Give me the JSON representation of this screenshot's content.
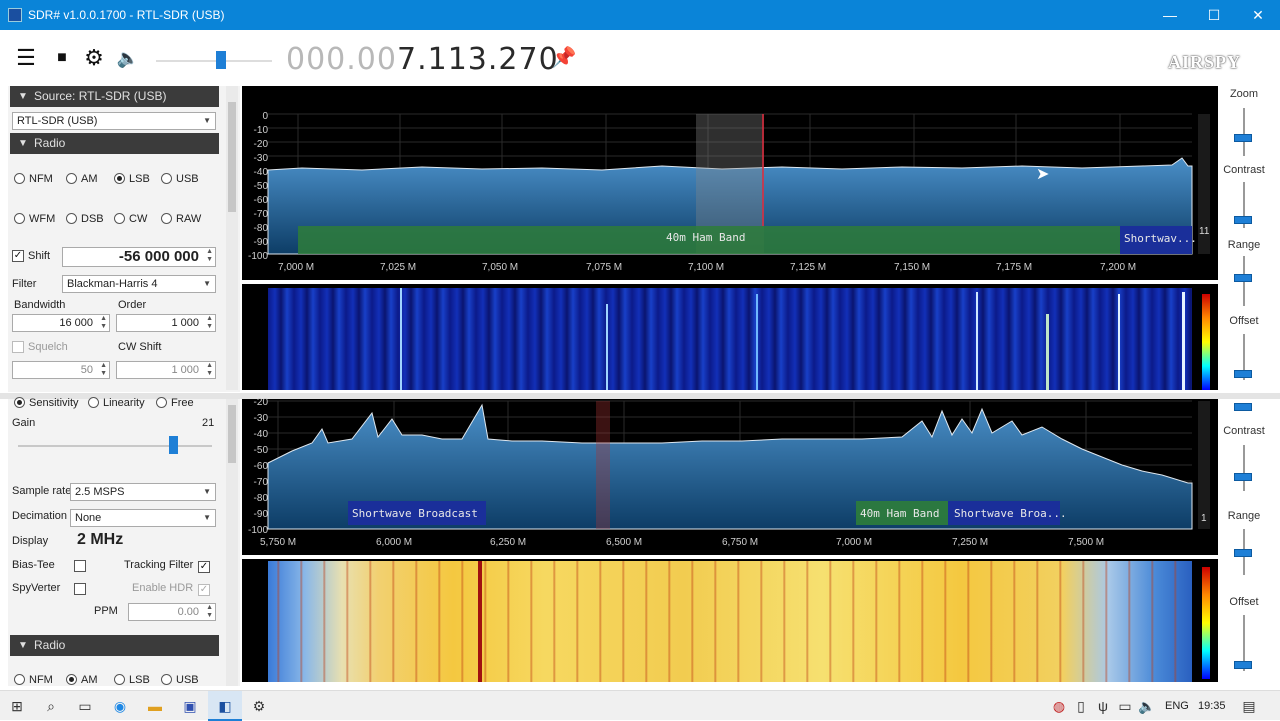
{
  "window": {
    "title": "SDR# v1.0.0.1700 - RTL-SDR (USB)",
    "minimize": "—",
    "maximize": "☐",
    "close": "✕"
  },
  "toolbar": {
    "freq_dim": "000.00",
    "freq_main": "7.113.270",
    "logo": "AIRSPY"
  },
  "panel1": {
    "source_header": "Source: RTL-SDR (USB)",
    "source_select": "RTL-SDR (USB)",
    "radio_header": "Radio",
    "modes_row1": [
      "NFM",
      "AM",
      "LSB",
      "USB"
    ],
    "modes_row2": [
      "WFM",
      "DSB",
      "CW",
      "RAW"
    ],
    "selected_mode": "LSB",
    "shift_label": "Shift",
    "shift_value": "-56 000 000",
    "filter_label": "Filter",
    "filter_value": "Blackman-Harris 4",
    "bandwidth_label": "Bandwidth",
    "bandwidth_value": "16 000",
    "order_label": "Order",
    "order_value": "1 000",
    "squelch_label": "Squelch",
    "squelch_value": "50",
    "cwshift_label": "CW Shift",
    "cwshift_value": "1 000"
  },
  "spectrum1": {
    "y_ticks": [
      "0",
      "-10",
      "-20",
      "-30",
      "-40",
      "-50",
      "-60",
      "-70",
      "-80",
      "-90",
      "-100"
    ],
    "x_ticks": [
      "7,000 M",
      "7,025 M",
      "7,050 M",
      "7,075 M",
      "7,100 M",
      "7,125 M",
      "7,150 M",
      "7,175 M",
      "7,200 M"
    ],
    "band_label": "40m Ham Band",
    "band2_label": "Shortwav...",
    "side_number": "11"
  },
  "side1": {
    "zoom": "Zoom",
    "contrast": "Contrast",
    "range": "Range",
    "offset": "Offset"
  },
  "panel2": {
    "tuner_options": [
      "Sensitivity",
      "Linearity",
      "Free"
    ],
    "gain_label": "Gain",
    "gain_value": "21",
    "gain_level": 0.78,
    "samplerate_label": "Sample rate",
    "samplerate_value": "2.5 MSPS",
    "decimation_label": "Decimation",
    "decimation_value": "None",
    "display_label": "Display",
    "display_value": "2 MHz",
    "biastee_label": "Bias-Tee",
    "tracking_label": "Tracking Filter",
    "spyverter_label": "SpyVerter",
    "hdr_label": "Enable HDR",
    "ppm_label": "PPM",
    "ppm_value": "0.00",
    "radio_header": "Radio",
    "modes_row1": [
      "NFM",
      "AM",
      "LSB",
      "USB"
    ]
  },
  "spectrum2": {
    "y_ticks": [
      "-20",
      "-30",
      "-40",
      "-50",
      "-60",
      "-70",
      "-80",
      "-90",
      "-100"
    ],
    "x_ticks": [
      "5,750 M",
      "6,000 M",
      "6,250 M",
      "6,500 M",
      "6,750 M",
      "7,000 M",
      "7,250 M",
      "7,500 M"
    ],
    "band_sw1": "Shortwave Broadcast",
    "band_ham": "40m Ham Band",
    "band_sw2": "Shortwave Broa...",
    "side_number": "1"
  },
  "side2": {
    "contrast": "Contrast",
    "range": "Range",
    "offset": "Offset"
  },
  "taskbar": {
    "lang": "ENG",
    "time": "19:35"
  }
}
